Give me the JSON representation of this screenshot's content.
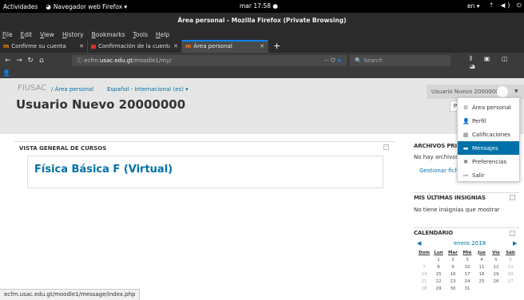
{
  "gnome": {
    "activities": "Actividades",
    "app_menu": "Navegador web Firefox ▾",
    "clock": "mar 17:58 ●",
    "lang": "en ▾",
    "tray": "⇡ ◀) ⏻"
  },
  "window": {
    "title": "Área personal - Mozilla Firefox (Private Browsing)"
  },
  "menubar": {
    "items": [
      "File",
      "Edit",
      "View",
      "History",
      "Bookmarks",
      "Tools",
      "Help"
    ]
  },
  "tabs": [
    {
      "label": "Confirme su cuenta",
      "icon": "m"
    },
    {
      "label": "Confirmación de la cuenta",
      "icon": "mail"
    },
    {
      "label": "Área personal",
      "icon": "m"
    }
  ],
  "navbar": {
    "url_prefix": "ⓘ ecfm.",
    "url_domain": "usac.edu.gt",
    "url_path": "/moodle1/my/",
    "url_tail": "··· ⛉",
    "url_star": "★",
    "search_placeholder": "🔍 Search",
    "right_icons": "⫴ ▣ ◫ ◕"
  },
  "bookmarks": {
    "user_icon": "person-icon"
  },
  "moodle": {
    "site_name": "FIUSAC",
    "breadcrumb": "/ Área personal",
    "language": "Español - Internacional (es) ▾",
    "user_name": "Usuario Nuevo 20000000",
    "page_title": "Usuario Nuevo 20000000",
    "customize_letter": "P",
    "user_menu": [
      {
        "label": "Área personal",
        "icon": "dashboard-icon",
        "glyph": "⚙",
        "active": false
      },
      {
        "label": "Perfil",
        "icon": "user-icon",
        "glyph": "👤",
        "active": false
      },
      {
        "label": "Calificaciones",
        "icon": "grades-icon",
        "glyph": "▦",
        "active": false
      },
      {
        "label": "Mensajes",
        "icon": "messages-icon",
        "glyph": "▬",
        "active": true
      },
      {
        "label": "Preferencias",
        "icon": "wrench-icon",
        "glyph": "✱",
        "active": false
      },
      {
        "label": "Salir",
        "icon": "logout-icon",
        "glyph": "↦",
        "active": false
      }
    ],
    "course_overview": {
      "title": "VISTA GENERAL DE CURSOS",
      "course": "Física Básica F (Virtual)"
    },
    "files_block": {
      "title": "ARCHIVOS PRIVADOS",
      "text": "No hay archivos disponibles",
      "link": "Gestionar ficheros privados..."
    },
    "badges_block": {
      "title": "MIS ÚLTIMAS INSIGNIAS",
      "text": "No tiene insignias que mostrar"
    },
    "calendar": {
      "title": "CALENDARIO",
      "month": "enero 2018",
      "days": [
        "Dom",
        "Lun",
        "Mar",
        "Mié",
        "Jue",
        "Vie",
        "Sáb"
      ],
      "weeks": [
        [
          "",
          "1",
          "2",
          "3",
          "4",
          "5",
          "6"
        ],
        [
          "7",
          "8",
          "9",
          "10",
          "11",
          "12",
          "13"
        ],
        [
          "14",
          "15",
          "16",
          "17",
          "18",
          "19",
          "20"
        ],
        [
          "21",
          "22",
          "23",
          "24",
          "25",
          "26",
          "27"
        ],
        [
          "28",
          "29",
          "30",
          "31",
          "",
          "",
          ""
        ]
      ]
    }
  },
  "status_bar": "ecfm.usac.edu.gt/moodle1/message/index.php"
}
